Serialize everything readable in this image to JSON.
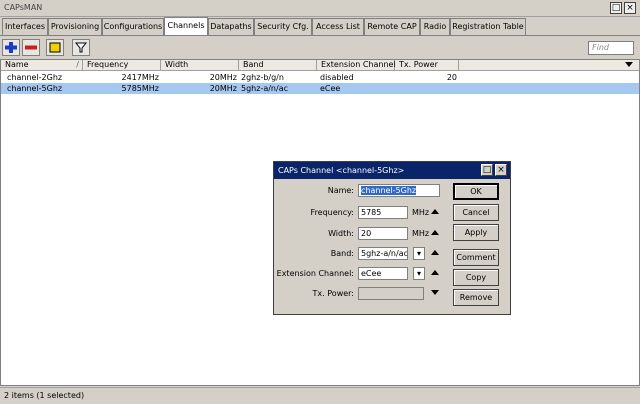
{
  "window": {
    "title": "CAPsMAN"
  },
  "tabs": [
    {
      "label": "Interfaces"
    },
    {
      "label": "Provisioning"
    },
    {
      "label": "Configurations"
    },
    {
      "label": "Channels"
    },
    {
      "label": "Datapaths"
    },
    {
      "label": "Security Cfg."
    },
    {
      "label": "Access List"
    },
    {
      "label": "Remote CAP"
    },
    {
      "label": "Radio"
    },
    {
      "label": "Registration Table"
    }
  ],
  "active_tab": "Channels",
  "toolbar": {
    "find_placeholder": "Find",
    "icons": [
      "plus-icon",
      "minus-icon",
      "comment-icon",
      "filter-icon"
    ]
  },
  "table": {
    "columns": [
      "Name",
      "Frequency",
      "Width",
      "Band",
      "Extension Channel",
      "Tx. Power"
    ],
    "rows": [
      {
        "name": "channel-2Ghz",
        "frequency": "2417MHz",
        "width": "20MHz",
        "band": "2ghz-b/g/n",
        "extension": "disabled",
        "tx_power": "20"
      },
      {
        "name": "channel-5Ghz",
        "frequency": "5785MHz",
        "width": "20MHz",
        "band": "5ghz-a/n/ac",
        "extension": "eCee",
        "tx_power": ""
      }
    ]
  },
  "status": "2 items (1 selected)",
  "dialog": {
    "title": "CAPs Channel <channel-5Ghz>",
    "labels": {
      "name": "Name:",
      "frequency": "Frequency:",
      "width": "Width:",
      "band": "Band:",
      "extension": "Extension Channel:",
      "tx_power": "Tx. Power:"
    },
    "values": {
      "name": "channel-5Ghz",
      "frequency": "5785",
      "width": "20",
      "band": "5ghz-a/n/ac",
      "extension": "eCee",
      "tx_power": ""
    },
    "units": {
      "frequency": "MHz",
      "width": "MHz"
    },
    "buttons": {
      "ok": "OK",
      "cancel": "Cancel",
      "apply": "Apply",
      "comment": "Comment",
      "copy": "Copy",
      "remove": "Remove"
    }
  },
  "colors": {
    "selection": "#a6c8f0",
    "dialog_title": "#0a246a",
    "plus_icon": "#1a3cc8",
    "minus_icon": "#c81e1e",
    "comment_icon": "#f0d000"
  }
}
